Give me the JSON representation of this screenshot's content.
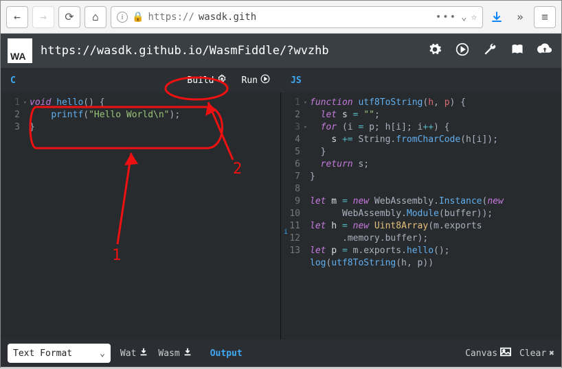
{
  "browser": {
    "url_display_prefix": "https://",
    "url_display_host": "wasdk.gith",
    "url_full": "https://wasdk.github.io/WasmFiddle/?wvzhb"
  },
  "app": {
    "logo_text": "WA",
    "title": "https://wasdk.github.io/WasmFiddle/?wvzhb"
  },
  "tabs": {
    "c_label": "C",
    "js_label": "JS",
    "build_label": "Build",
    "run_label": "Run"
  },
  "editor_c": {
    "lines": [
      "1",
      "2",
      "3"
    ],
    "code": {
      "l1_kw": "void",
      "l1_fn": " hello",
      "l1_rest": "() {",
      "l2_fn": "printf",
      "l2_paren_open": "(",
      "l2_str": "\"Hello World\\n\"",
      "l2_paren_close": ");",
      "l3": "}"
    }
  },
  "editor_js": {
    "lines": [
      "1",
      "2",
      "3",
      "4",
      "5",
      "6",
      "7",
      "8",
      "9",
      "10",
      "11",
      "12",
      "13"
    ],
    "c": {
      "l1a": "function",
      "l1b": " utf8ToString",
      "l1c": "(",
      "l1d": "h",
      "l1e": ", ",
      "l1f": "p",
      "l1g": ") {",
      "l2a": "let",
      "l2b": " s ",
      "l2c": "=",
      "l2d": " \"\"",
      "l2e": ";",
      "l3a": "for",
      "l3b": " (i ",
      "l3c": "=",
      "l3d": " p; h[i]; i",
      "l3e": "++",
      "l3f": ") {",
      "l4a": "s ",
      "l4b": "+=",
      "l4c": " String.",
      "l4d": "fromCharCode",
      "l4e": "(h[i]);",
      "l5": "}",
      "l6a": "return",
      "l6b": " s;",
      "l7": "}",
      "l9a": "let",
      "l9b": " m ",
      "l9c": "=",
      "l9d": " new",
      "l9e": " WebAssembly.",
      "l9f": "Instance",
      "l9g": "(",
      "l9h": "new",
      "l9ib": "WebAssembly.",
      "l9ic": "Module",
      "l9id": "(buffer));",
      "l10a": "let",
      "l10b": " h ",
      "l10c": "=",
      "l10d": " new",
      "l10e": " Uint8Array",
      "l10f": "(m.exports",
      "l10g": ".memory.buffer);",
      "l11a": "let",
      "l11b": " p ",
      "l11c": "=",
      "l11d": " m.exports.",
      "l11e": "hello",
      "l11f": "();",
      "l12a": "log",
      "l12b": "(",
      "l12c": "utf8ToString",
      "l12d": "(h, p))"
    }
  },
  "bottom": {
    "dropdown_label": "Text Format",
    "wat": "Wat",
    "wasm": "Wasm",
    "output": "Output",
    "canvas": "Canvas",
    "clear": "Clear"
  },
  "annotations": {
    "label1": "1",
    "label2": "2"
  }
}
